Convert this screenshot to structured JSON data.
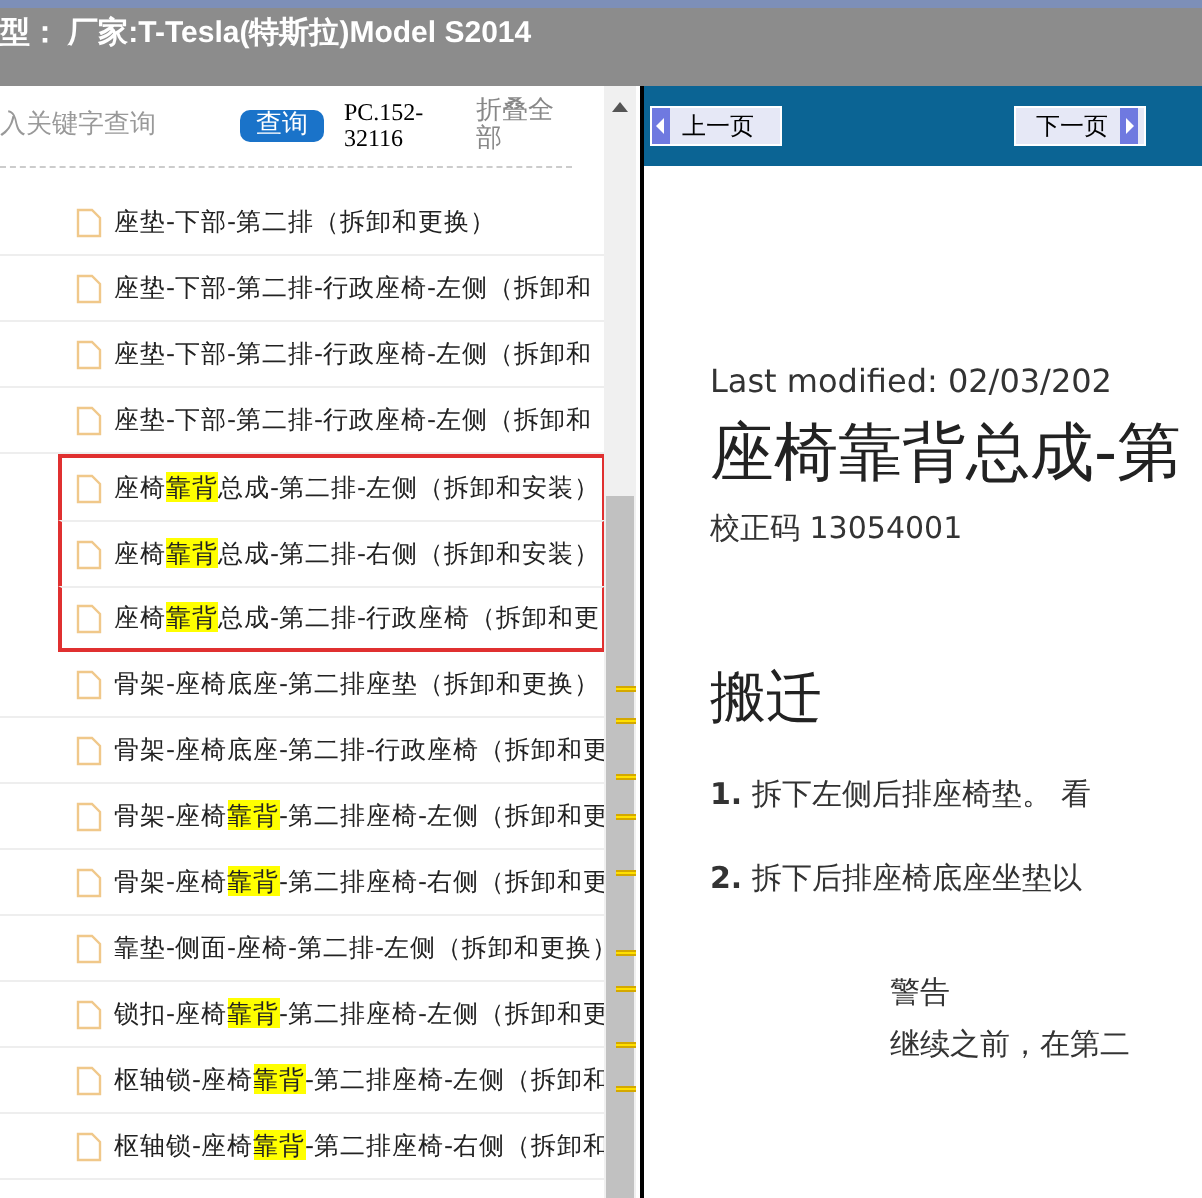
{
  "title_bar": {
    "title": "型： 厂家:T-Tesla(特斯拉)Model S2014"
  },
  "search": {
    "placeholder": "入关键字查询",
    "button": "查询",
    "code": "PC.152-32116",
    "collapse": "折叠全部"
  },
  "tree_items": [
    {
      "parts": [
        {
          "text": "座垫-下部-第二排（拆卸和更换）",
          "highlight": false
        }
      ],
      "framed": false
    },
    {
      "parts": [
        {
          "text": "座垫-下部-第二排-行政座椅-左侧（拆卸和",
          "highlight": false
        }
      ],
      "framed": false
    },
    {
      "parts": [
        {
          "text": "座垫-下部-第二排-行政座椅-左侧（拆卸和",
          "highlight": false
        }
      ],
      "framed": false
    },
    {
      "parts": [
        {
          "text": "座垫-下部-第二排-行政座椅-左侧（拆卸和",
          "highlight": false
        }
      ],
      "framed": false
    },
    {
      "parts": [
        {
          "text": "座椅",
          "highlight": false
        },
        {
          "text": "靠背",
          "highlight": true
        },
        {
          "text": "总成-第二排-左侧（拆卸和安装）",
          "highlight": false
        }
      ],
      "framed": true
    },
    {
      "parts": [
        {
          "text": "座椅",
          "highlight": false
        },
        {
          "text": "靠背",
          "highlight": true
        },
        {
          "text": "总成-第二排-右侧（拆卸和安装）",
          "highlight": false
        }
      ],
      "framed": true
    },
    {
      "parts": [
        {
          "text": "座椅",
          "highlight": false
        },
        {
          "text": "靠背",
          "highlight": true
        },
        {
          "text": "总成-第二排-行政座椅（拆卸和更",
          "highlight": false
        }
      ],
      "framed": true
    },
    {
      "parts": [
        {
          "text": "骨架-座椅底座-第二排座垫（拆卸和更换）",
          "highlight": false
        }
      ],
      "framed": false
    },
    {
      "parts": [
        {
          "text": "骨架-座椅底座-第二排-行政座椅（拆卸和更",
          "highlight": false
        }
      ],
      "framed": false
    },
    {
      "parts": [
        {
          "text": "骨架-座椅",
          "highlight": false
        },
        {
          "text": "靠背",
          "highlight": true
        },
        {
          "text": "-第二排座椅-左侧（拆卸和更",
          "highlight": false
        }
      ],
      "framed": false
    },
    {
      "parts": [
        {
          "text": "骨架-座椅",
          "highlight": false
        },
        {
          "text": "靠背",
          "highlight": true
        },
        {
          "text": "-第二排座椅-右侧（拆卸和更",
          "highlight": false
        }
      ],
      "framed": false
    },
    {
      "parts": [
        {
          "text": "靠垫-侧面-座椅-第二排-左侧（拆卸和更换）",
          "highlight": false
        }
      ],
      "framed": false
    },
    {
      "parts": [
        {
          "text": "锁扣-座椅",
          "highlight": false
        },
        {
          "text": "靠背",
          "highlight": true
        },
        {
          "text": "-第二排座椅-左侧（拆卸和更",
          "highlight": false
        }
      ],
      "framed": false
    },
    {
      "parts": [
        {
          "text": "枢轴锁-座椅",
          "highlight": false
        },
        {
          "text": "靠背",
          "highlight": true
        },
        {
          "text": "-第二排座椅-左侧（拆卸和",
          "highlight": false
        }
      ],
      "framed": false
    },
    {
      "parts": [
        {
          "text": "枢轴锁-座椅",
          "highlight": false
        },
        {
          "text": "靠背",
          "highlight": true
        },
        {
          "text": "-第二排座椅-右侧（拆卸和",
          "highlight": false
        }
      ],
      "framed": false
    }
  ],
  "nav": {
    "prev": "上一页",
    "next": "下一页"
  },
  "document": {
    "modified": "Last modified: 02/03/202",
    "title": "座椅靠背总成-第",
    "code": "校正码 13054001",
    "section": "搬迁",
    "steps": [
      {
        "number": "1.",
        "text": "拆下左侧后排座椅垫。 看"
      },
      {
        "number": "2.",
        "text": "拆下后排座椅底座坐垫以"
      }
    ],
    "warning": {
      "label": "警告",
      "text": "继续之前，在第二"
    }
  }
}
